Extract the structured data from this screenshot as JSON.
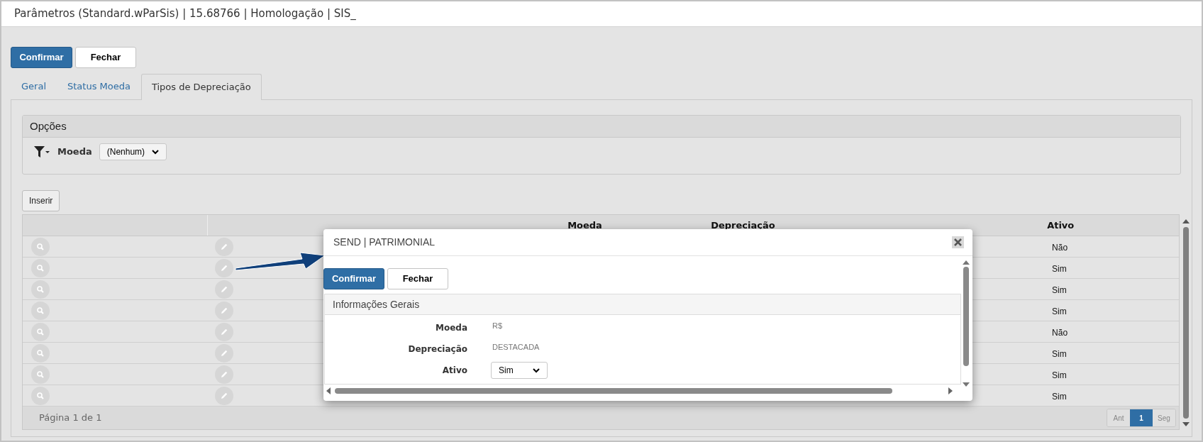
{
  "window": {
    "title": "Parâmetros (Standard.wParSis) | 15.68766 | Homologação | SIS_"
  },
  "toolbar": {
    "buttons": [
      {
        "label": "Confirmar",
        "kind": "primary"
      },
      {
        "label": "Fechar",
        "kind": "default"
      }
    ]
  },
  "tabs": [
    {
      "label": "Geral",
      "selected": false
    },
    {
      "label": "Status Moeda",
      "selected": false
    },
    {
      "label": "Tipos de Depreciação",
      "selected": true
    }
  ],
  "options_panel": {
    "title": "Opções",
    "filter": {
      "label": "Moeda",
      "value": "(Nenhum)"
    }
  },
  "insert_button": "Inserir",
  "table": {
    "columns": [
      {
        "label": "Moeda"
      },
      {
        "label": "Depreciação"
      },
      {
        "label": "Ativo"
      }
    ],
    "rows": [
      {
        "ativo": "Não"
      },
      {
        "ativo": "Sim"
      },
      {
        "ativo": "Sim"
      },
      {
        "ativo": "Sim"
      },
      {
        "ativo": "Não"
      },
      {
        "ativo": "Sim"
      },
      {
        "ativo": "Sim"
      },
      {
        "ativo": "Sim"
      }
    ],
    "footer": "Página 1 de 1",
    "pagination": [
      {
        "label": "Ant",
        "selected": false
      },
      {
        "label": "1",
        "selected": true
      },
      {
        "label": "Seg",
        "selected": false
      }
    ]
  },
  "dialog": {
    "title": "SEND | PATRIMONIAL",
    "buttons": [
      {
        "label": "Confirmar",
        "kind": "primary"
      },
      {
        "label": "Fechar",
        "kind": "default"
      }
    ],
    "section": "Informações Gerais",
    "fields": [
      {
        "label": "Moeda",
        "kind": "text",
        "value": "R$"
      },
      {
        "label": "Depreciação",
        "kind": "text",
        "value": "DESTACADA"
      },
      {
        "label": "Ativo",
        "kind": "select",
        "value": "Sim"
      }
    ]
  }
}
